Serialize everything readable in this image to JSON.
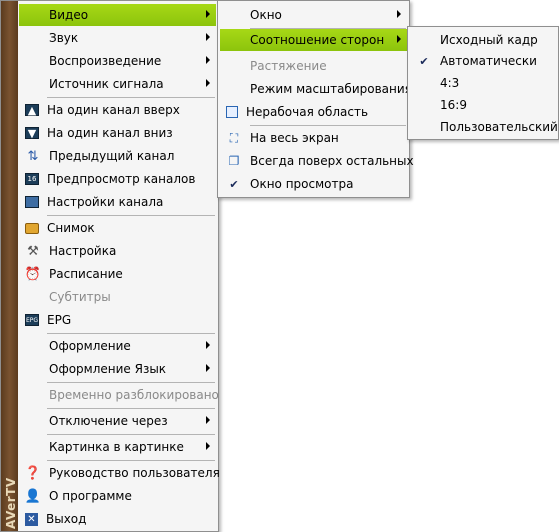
{
  "brand": "AVerTV",
  "main_menu": {
    "video": "Видео",
    "sound": "Звук",
    "playback": "Воспроизведение",
    "signal_source": "Источник сигнала",
    "channel_up": "На один канал вверх",
    "channel_down": "На один канал вниз",
    "prev_channel": "Предыдущий канал",
    "channel_preview": "Предпросмотр каналов",
    "channel_settings": "Настройки канала",
    "snapshot": "Снимок",
    "setup": "Настройка",
    "schedule": "Расписание",
    "subtitles": "Субтитры",
    "epg": "EPG",
    "skin": "Оформление",
    "skin_language": "Оформление Язык",
    "temp_unlocked": "Временно разблокировано",
    "shutdown_after": "Отключение через",
    "pip": "Картинка в картинке",
    "user_guide": "Руководство пользователя",
    "about": "О программе",
    "exit": "Выход"
  },
  "video_submenu": {
    "window": "Окно",
    "aspect_ratio": "Соотношение сторон",
    "stretch": "Растяжение",
    "scaling_mode": "Режим масштабирования",
    "inactive_area": "Нерабочая область",
    "fullscreen": "На весь экран",
    "always_on_top": "Всегда поверх остальных",
    "preview_window": "Окно просмотра"
  },
  "aspect_submenu": {
    "original": "Исходный кадр",
    "auto": "Автоматически",
    "r43": "4:3",
    "r169": "16:9",
    "custom": "Пользовательский"
  },
  "colors": {
    "highlight": "#96cc0e",
    "brand_strip": "#6b4727"
  }
}
